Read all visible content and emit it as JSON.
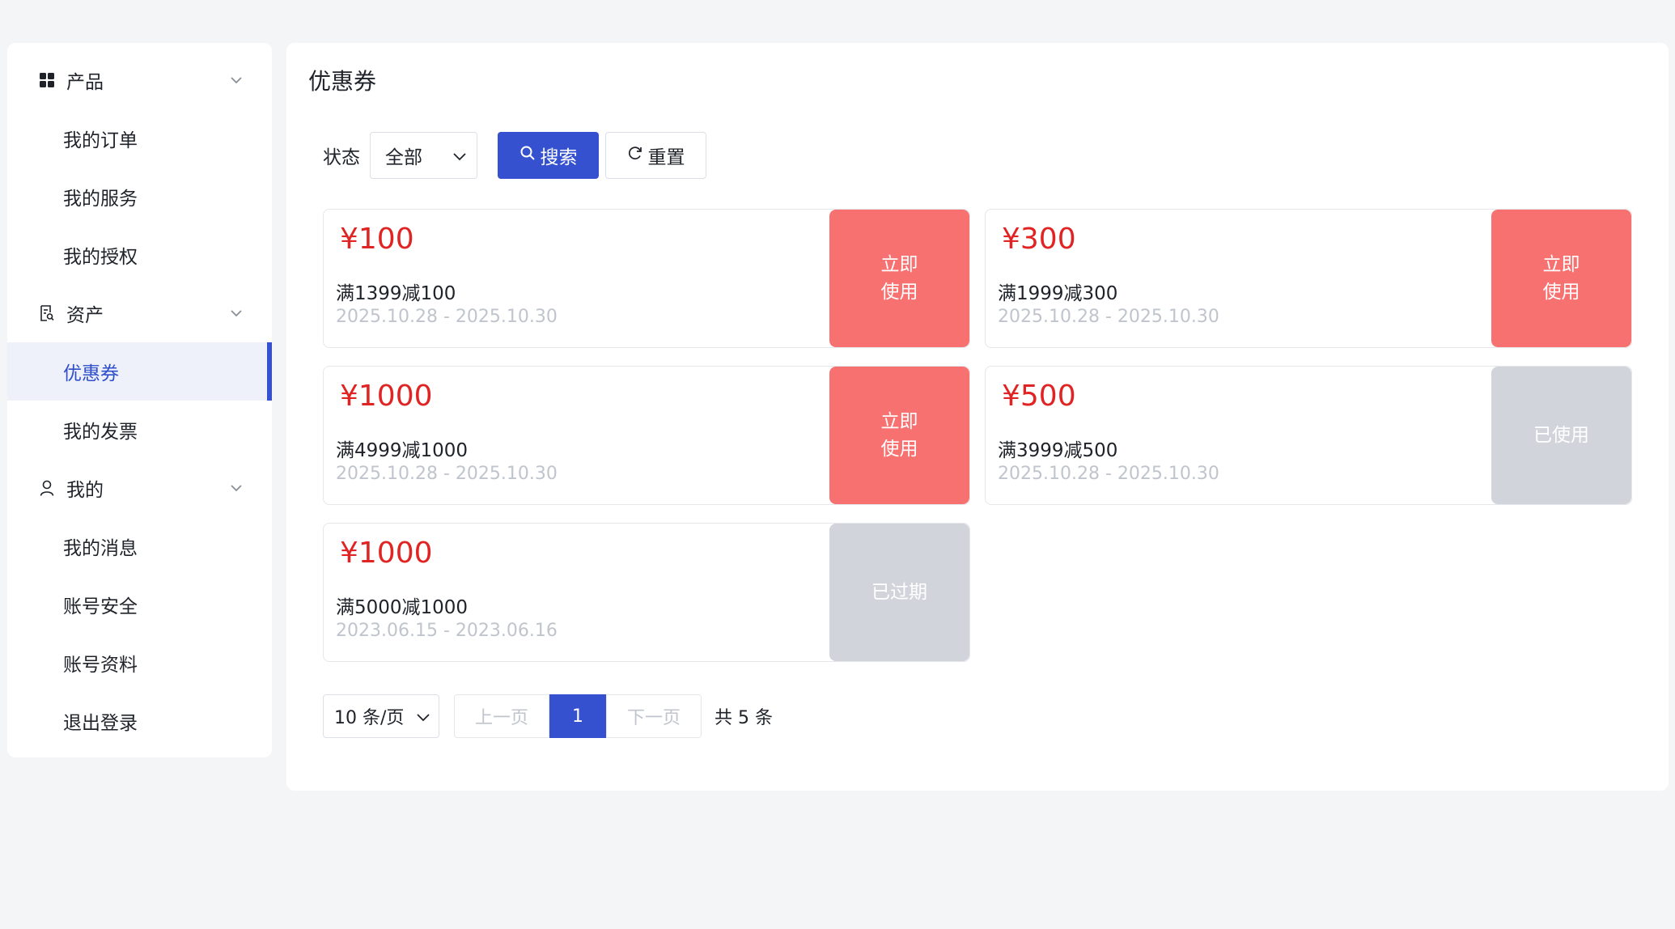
{
  "sidebar": {
    "groups": [
      {
        "label": "产品",
        "icon": "grid-icon",
        "items": [
          "我的订单",
          "我的服务",
          "我的授权"
        ]
      },
      {
        "label": "资产",
        "icon": "document-search-icon",
        "items": [
          "优惠券",
          "我的发票"
        ]
      },
      {
        "label": "我的",
        "icon": "user-icon",
        "items": [
          "我的消息",
          "账号安全",
          "账号资料",
          "退出登录"
        ]
      }
    ],
    "active_item": "优惠券"
  },
  "page": {
    "title": "优惠券"
  },
  "filter": {
    "status_label": "状态",
    "status_value": "全部",
    "search_label": "搜索",
    "reset_label": "重置"
  },
  "coupons": [
    {
      "amount": "¥100",
      "rule": "满1399减100",
      "period": "2025.10.28 - 2025.10.30",
      "action": "立即\n使用",
      "state": "available"
    },
    {
      "amount": "¥300",
      "rule": "满1999减300",
      "period": "2025.10.28 - 2025.10.30",
      "action": "立即\n使用",
      "state": "available"
    },
    {
      "amount": "¥1000",
      "rule": "满4999减1000",
      "period": "2025.10.28 - 2025.10.30",
      "action": "立即\n使用",
      "state": "available"
    },
    {
      "amount": "¥500",
      "rule": "满3999减500",
      "period": "2025.10.28 - 2025.10.30",
      "action": "已使用",
      "state": "used"
    },
    {
      "amount": "¥1000",
      "rule": "满5000减1000",
      "period": "2023.06.15 - 2023.06.16",
      "action": "已过期",
      "state": "expired"
    }
  ],
  "pagination": {
    "page_size": "10 条/页",
    "prev": "上一页",
    "current": "1",
    "next": "下一页",
    "total": "共 5 条"
  },
  "colors": {
    "primary": "#3551cf",
    "price": "#e02424",
    "use_button": "#f87171",
    "disabled_button": "#d1d5db"
  }
}
